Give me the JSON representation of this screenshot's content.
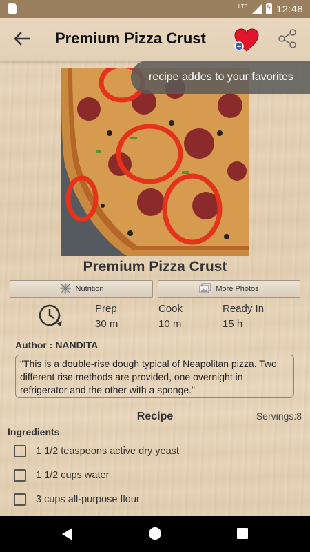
{
  "status_bar": {
    "network_label": "LTE",
    "time": "12:48"
  },
  "app_bar": {
    "title": "Premium Pizza Crust",
    "icons": [
      "back-arrow-icon",
      "favorite-heart-icon",
      "share-icon"
    ]
  },
  "toast": {
    "message": "recipe addes to your favorites"
  },
  "recipe": {
    "title": "Premium Pizza Crust",
    "buttons": {
      "nutrition": "Nutrition",
      "more_photos": "More Photos"
    },
    "times": [
      {
        "label": "Prep",
        "value": "30 m"
      },
      {
        "label": "Cook",
        "value": "10 m"
      },
      {
        "label": "Ready In",
        "value": "15 h"
      }
    ],
    "author": "Author : NANDITA",
    "description": "\"This is a double-rise dough typical of Neapolitan pizza. Two different rise methods are provided, one overnight in refrigerator and the other with a sponge.\"",
    "section_title": "Recipe",
    "servings": "Servings:8",
    "ingredients_heading": "Ingredients",
    "ingredients": [
      "1 1/2 teaspoons active dry yeast",
      "1 1/2 cups water",
      "3 cups all-purpose flour"
    ]
  },
  "colors": {
    "status_bar": "#9a7f5e",
    "background": "#e7d6bd",
    "heart": "#e0152b"
  }
}
